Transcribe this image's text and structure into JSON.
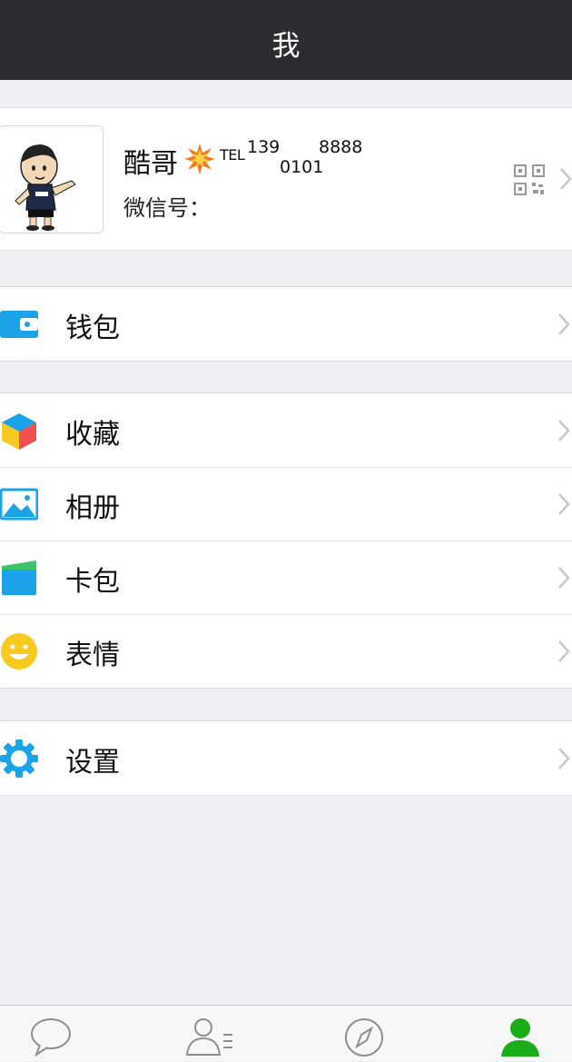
{
  "header": {
    "title": "我"
  },
  "profile": {
    "name": "酷哥",
    "tel_label": "TEL",
    "phone_part1": "139",
    "phone_part2": "0101",
    "phone_part3": "8888",
    "wechat_id_label": "微信号："
  },
  "menu": {
    "wallet": "钱包",
    "favorites": "收藏",
    "album": "相册",
    "card_pack": "卡包",
    "stickers": "表情",
    "settings": "设置"
  },
  "colors": {
    "nav_bg": "#2d2d31",
    "page_bg": "#efeff4",
    "accent_blue": "#1aa3e8",
    "active_green": "#1aad19"
  },
  "tabs": [
    {
      "icon": "chat-bubble-icon",
      "active": false
    },
    {
      "icon": "contacts-icon",
      "active": false
    },
    {
      "icon": "discover-compass-icon",
      "active": false
    },
    {
      "icon": "me-person-icon",
      "active": true
    }
  ]
}
